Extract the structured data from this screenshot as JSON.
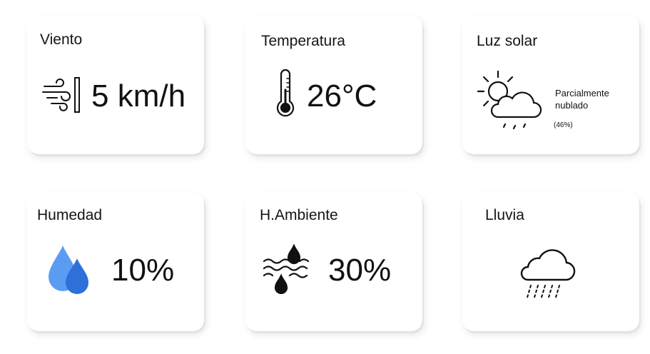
{
  "cards": {
    "wind": {
      "title": "Viento",
      "value": "5 km/h",
      "icon": "wind-icon"
    },
    "temperature": {
      "title": "Temperatura",
      "value": "26°C",
      "icon": "thermometer-icon"
    },
    "sunlight": {
      "title": "Luz solar",
      "condition": "Parcialmente nublado",
      "percent": "(46%)",
      "icon": "partly-cloudy-icon"
    },
    "humidity": {
      "title": "Humedad",
      "value": "10%",
      "icon": "water-drops-icon",
      "icon_color": "#3b82f6"
    },
    "ambient_humidity": {
      "title": "H.Ambiente",
      "value": "30%",
      "icon": "humidity-waves-icon"
    },
    "rain": {
      "title": "Lluvia",
      "icon": "rain-cloud-icon"
    }
  }
}
